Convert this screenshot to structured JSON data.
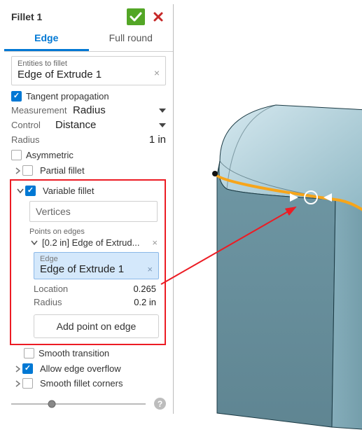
{
  "title": "Fillet 1",
  "tabs": {
    "edge": "Edge",
    "full_round": "Full round"
  },
  "entities": {
    "label": "Entities to fillet",
    "value": "Edge of Extrude 1"
  },
  "tangent_propagation": "Tangent propagation",
  "measurement": {
    "label": "Measurement",
    "value": "Radius"
  },
  "control": {
    "label": "Control",
    "value": "Distance"
  },
  "radius": {
    "label": "Radius",
    "value": "1 in"
  },
  "asymmetric": "Asymmetric",
  "partial_fillet": "Partial fillet",
  "variable_fillet": "Variable fillet",
  "vertices_placeholder": "Vertices",
  "points_on_edges_label": "Points on edges",
  "point_item": {
    "summary": "[0.2 in] Edge of Extrud...",
    "edge_label": "Edge",
    "edge_value": "Edge of Extrude 1",
    "location": {
      "label": "Location",
      "value": "0.265"
    },
    "radius": {
      "label": "Radius",
      "value": "0.2 in"
    },
    "add_button": "Add point on edge"
  },
  "smooth_transition": "Smooth transition",
  "allow_edge_overflow": "Allow edge overflow",
  "smooth_fillet_corners": "Smooth fillet corners",
  "colors": {
    "accent": "#0078d4",
    "highlight": "#ec1c24",
    "model_edge": "#f7a51a",
    "model_body": "#a5c8d1"
  }
}
